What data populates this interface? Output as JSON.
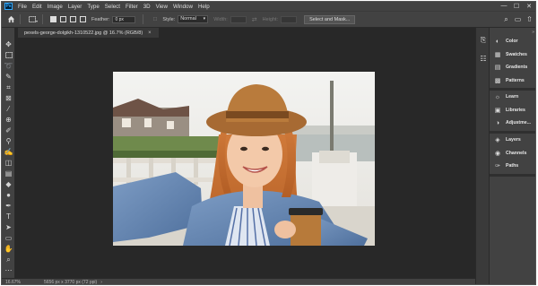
{
  "app": {
    "logo_text": "Ps",
    "menu": [
      "File",
      "Edit",
      "Image",
      "Layer",
      "Type",
      "Select",
      "Filter",
      "3D",
      "View",
      "Window",
      "Help"
    ],
    "window_controls": [
      "—",
      "☐",
      "✕"
    ]
  },
  "options": {
    "feather_label": "Feather:",
    "feather_value": "0 px",
    "style_label": "Style:",
    "style_value": "Normal",
    "width_label": "Width:",
    "height_label": "Height:",
    "select_mask_button": "Select and Mask..."
  },
  "document": {
    "tab_title": "pexels-george-dolgikh-1310522.jpg @ 16.7% (RGB/8)",
    "tab_close": "×"
  },
  "status": {
    "zoom": "16.67%",
    "info": "5656 px x 3770 px (72 ppi)",
    "arrow": "›"
  },
  "panels": {
    "group1": [
      "Color",
      "Swatches",
      "Gradients",
      "Patterns"
    ],
    "group2": [
      "Learn",
      "Libraries",
      "Adjustme..."
    ],
    "group3": [
      "Layers",
      "Channels",
      "Paths"
    ]
  },
  "colors": {
    "app_bg": "#323232",
    "bar_bg": "#424242",
    "canvas_bg": "#282828",
    "accent": "#31a8ff"
  }
}
